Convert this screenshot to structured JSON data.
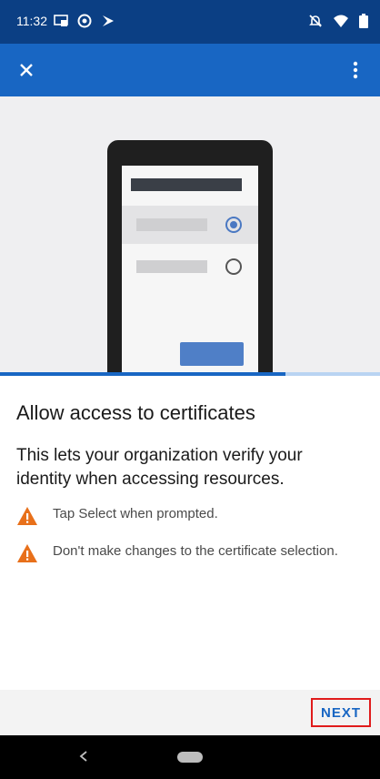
{
  "status_bar": {
    "time": "11:32",
    "left_icons": [
      "cast-icon",
      "sync-icon",
      "signal-alt-icon"
    ],
    "right_icons": [
      "do-not-disturb-icon",
      "wifi-icon",
      "battery-icon"
    ]
  },
  "app_bar": {
    "close_icon": "close-icon",
    "more_icon": "more-vertical-icon",
    "color": "#1866c3"
  },
  "progress": {
    "value": 0.75
  },
  "content": {
    "title": "Allow access to certificates",
    "description": "This lets your organization verify your identity when accessing resources.",
    "notes": [
      {
        "icon": "warning-icon",
        "text": "Tap Select when prompted."
      },
      {
        "icon": "warning-icon",
        "text": "Don't make changes to the certificate selection."
      }
    ]
  },
  "footer": {
    "next_label": "NEXT",
    "accent_color": "#1866c3",
    "highlight_color": "#e01b1b"
  },
  "status_colors": {
    "warning": "#e8701a",
    "status_bar": "#0b3f84"
  }
}
